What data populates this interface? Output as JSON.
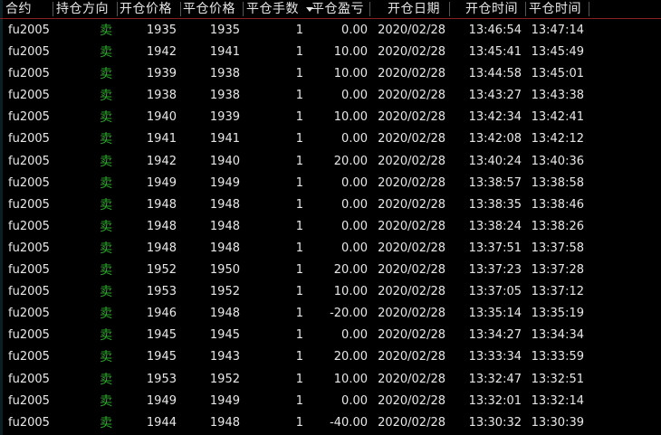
{
  "header": {
    "contract": "合约",
    "direction": "持仓方向",
    "open_price": "开仓价格",
    "close_price": "平仓价格",
    "quantity": "平仓手数",
    "pnl": "平仓盈亏",
    "open_date": "开仓日期",
    "open_time": "开仓时间",
    "close_time": "平仓时间"
  },
  "colors": {
    "sell": "#2aa82a",
    "header_border": "#8a2020",
    "background": "#000000"
  },
  "rows": [
    {
      "contract": "fu2005",
      "direction": "卖",
      "open_price": "1935",
      "close_price": "1935",
      "quantity": "1",
      "pnl": "0.00",
      "open_date": "2020/02/28",
      "open_time": "13:46:54",
      "close_time": "13:47:14"
    },
    {
      "contract": "fu2005",
      "direction": "卖",
      "open_price": "1942",
      "close_price": "1941",
      "quantity": "1",
      "pnl": "10.00",
      "open_date": "2020/02/28",
      "open_time": "13:45:41",
      "close_time": "13:45:49"
    },
    {
      "contract": "fu2005",
      "direction": "卖",
      "open_price": "1939",
      "close_price": "1938",
      "quantity": "1",
      "pnl": "10.00",
      "open_date": "2020/02/28",
      "open_time": "13:44:58",
      "close_time": "13:45:01"
    },
    {
      "contract": "fu2005",
      "direction": "卖",
      "open_price": "1938",
      "close_price": "1938",
      "quantity": "1",
      "pnl": "0.00",
      "open_date": "2020/02/28",
      "open_time": "13:43:27",
      "close_time": "13:43:38"
    },
    {
      "contract": "fu2005",
      "direction": "卖",
      "open_price": "1940",
      "close_price": "1939",
      "quantity": "1",
      "pnl": "10.00",
      "open_date": "2020/02/28",
      "open_time": "13:42:34",
      "close_time": "13:42:41"
    },
    {
      "contract": "fu2005",
      "direction": "卖",
      "open_price": "1941",
      "close_price": "1941",
      "quantity": "1",
      "pnl": "0.00",
      "open_date": "2020/02/28",
      "open_time": "13:42:08",
      "close_time": "13:42:12"
    },
    {
      "contract": "fu2005",
      "direction": "卖",
      "open_price": "1942",
      "close_price": "1940",
      "quantity": "1",
      "pnl": "20.00",
      "open_date": "2020/02/28",
      "open_time": "13:40:24",
      "close_time": "13:40:36"
    },
    {
      "contract": "fu2005",
      "direction": "卖",
      "open_price": "1949",
      "close_price": "1949",
      "quantity": "1",
      "pnl": "0.00",
      "open_date": "2020/02/28",
      "open_time": "13:38:57",
      "close_time": "13:38:58"
    },
    {
      "contract": "fu2005",
      "direction": "卖",
      "open_price": "1948",
      "close_price": "1948",
      "quantity": "1",
      "pnl": "0.00",
      "open_date": "2020/02/28",
      "open_time": "13:38:35",
      "close_time": "13:38:46"
    },
    {
      "contract": "fu2005",
      "direction": "卖",
      "open_price": "1948",
      "close_price": "1948",
      "quantity": "1",
      "pnl": "0.00",
      "open_date": "2020/02/28",
      "open_time": "13:38:24",
      "close_time": "13:38:26"
    },
    {
      "contract": "fu2005",
      "direction": "卖",
      "open_price": "1948",
      "close_price": "1948",
      "quantity": "1",
      "pnl": "0.00",
      "open_date": "2020/02/28",
      "open_time": "13:37:51",
      "close_time": "13:37:58"
    },
    {
      "contract": "fu2005",
      "direction": "卖",
      "open_price": "1952",
      "close_price": "1950",
      "quantity": "1",
      "pnl": "20.00",
      "open_date": "2020/02/28",
      "open_time": "13:37:23",
      "close_time": "13:37:28"
    },
    {
      "contract": "fu2005",
      "direction": "卖",
      "open_price": "1953",
      "close_price": "1952",
      "quantity": "1",
      "pnl": "10.00",
      "open_date": "2020/02/28",
      "open_time": "13:37:05",
      "close_time": "13:37:12"
    },
    {
      "contract": "fu2005",
      "direction": "卖",
      "open_price": "1946",
      "close_price": "1948",
      "quantity": "1",
      "pnl": "-20.00",
      "open_date": "2020/02/28",
      "open_time": "13:35:14",
      "close_time": "13:35:19"
    },
    {
      "contract": "fu2005",
      "direction": "卖",
      "open_price": "1945",
      "close_price": "1945",
      "quantity": "1",
      "pnl": "0.00",
      "open_date": "2020/02/28",
      "open_time": "13:34:27",
      "close_time": "13:34:34"
    },
    {
      "contract": "fu2005",
      "direction": "卖",
      "open_price": "1945",
      "close_price": "1943",
      "quantity": "1",
      "pnl": "20.00",
      "open_date": "2020/02/28",
      "open_time": "13:33:34",
      "close_time": "13:33:59"
    },
    {
      "contract": "fu2005",
      "direction": "卖",
      "open_price": "1953",
      "close_price": "1952",
      "quantity": "1",
      "pnl": "10.00",
      "open_date": "2020/02/28",
      "open_time": "13:32:47",
      "close_time": "13:32:51"
    },
    {
      "contract": "fu2005",
      "direction": "卖",
      "open_price": "1949",
      "close_price": "1949",
      "quantity": "1",
      "pnl": "0.00",
      "open_date": "2020/02/28",
      "open_time": "13:32:01",
      "close_time": "13:32:14"
    },
    {
      "contract": "fu2005",
      "direction": "卖",
      "open_price": "1944",
      "close_price": "1948",
      "quantity": "1",
      "pnl": "-40.00",
      "open_date": "2020/02/28",
      "open_time": "13:30:32",
      "close_time": "13:30:39"
    }
  ]
}
